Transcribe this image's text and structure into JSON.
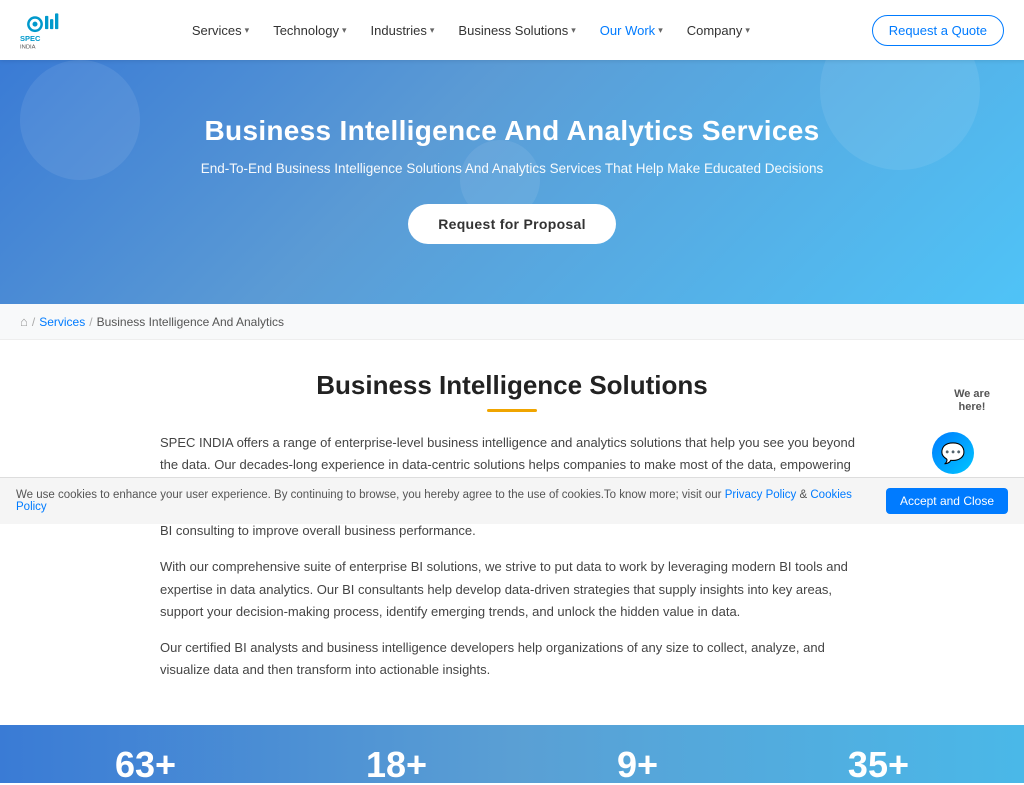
{
  "navbar": {
    "logo_alt": "SPEC INDIA",
    "nav_items": [
      {
        "label": "Services",
        "has_dropdown": true
      },
      {
        "label": "Technology",
        "has_dropdown": true
      },
      {
        "label": "Industries",
        "has_dropdown": true
      },
      {
        "label": "Business Solutions",
        "has_dropdown": true
      },
      {
        "label": "Our Work",
        "has_dropdown": true
      },
      {
        "label": "Company",
        "has_dropdown": true
      }
    ],
    "cta_label": "Request a Quote"
  },
  "hero": {
    "title": "Business Intelligence And Analytics Services",
    "subtitle": "End-To-End Business Intelligence Solutions And Analytics Services That Help Make Educated Decisions",
    "button_label": "Request for Proposal"
  },
  "breadcrumb": {
    "home_icon": "🏠",
    "sep1": "/",
    "link_label": "Services",
    "sep2": "/",
    "current": "Business Intelligence And Analytics"
  },
  "main": {
    "section_title": "Business Intelligence Solutions",
    "para1": "SPEC INDIA offers a range of enterprise-level business intelligence and analytics solutions that help you see you beyond the data. Our decades-long experience in data-centric solutions helps companies to make most of the data, empowering businesses to improve the decision-making process based on the intelligent interpretation of data. Our Business Intelligence services include BI reporting, dashboarding, data warehousing, smart analytics, custom data visualization, and BI consulting to improve overall business performance.",
    "para2": "With our comprehensive suite of enterprise BI solutions, we strive to put data to work by leveraging modern BI tools and expertise in data analytics. Our BI consultants help develop data-driven strategies that supply insights into key areas, support your decision-making process, identify emerging trends, and unlock the hidden value in data.",
    "para3": "Our certified BI analysts and business intelligence developers help organizations of any size to collect, analyze, and visualize data and then transform into actionable insights."
  },
  "stats": [
    {
      "number": "63+",
      "label": ""
    },
    {
      "number": "18+",
      "label": ""
    },
    {
      "number": "9+",
      "label": ""
    },
    {
      "number": "35+",
      "label": ""
    }
  ],
  "cookie": {
    "text": "We use cookies to enhance your user experience. By continuing to browse, you hereby agree to the use of cookies.To know more; visit our ",
    "privacy_label": "Privacy Policy",
    "amp": " & ",
    "cookies_label": "Cookies Policy",
    "button_label": "Accept and Close"
  },
  "chat": {
    "we_are_here_line1": "We are",
    "we_are_here_line2": "here!"
  }
}
